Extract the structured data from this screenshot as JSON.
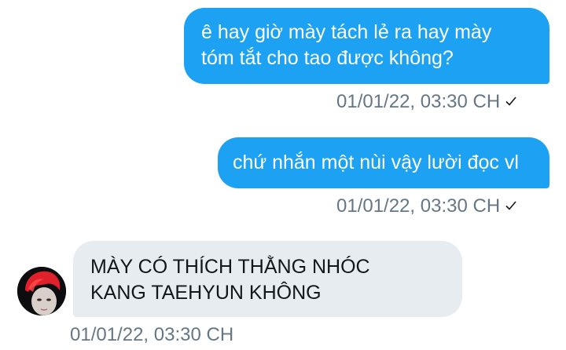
{
  "messages": [
    {
      "direction": "sent",
      "text": "ê hay giờ mày tách lẻ ra hay mày\ntóm tắt cho tao được không?",
      "timestamp": "01/01/22, 03:30 CH",
      "status_icon": "check-icon"
    },
    {
      "direction": "sent",
      "text": "chứ nhắn một nùi vậy lười đọc vl",
      "timestamp": "01/01/22, 03:30 CH",
      "status_icon": "check-icon"
    },
    {
      "direction": "received",
      "text": "MÀY CÓ THÍCH THẰNG NHÓC\nKANG TAEHYUN KHÔNG",
      "timestamp": "01/01/22, 03:30 CH",
      "avatar_icon": "user-avatar"
    }
  ],
  "colors": {
    "sent_bubble": "#1da1f2",
    "received_bubble": "#e6ecf0",
    "timestamp": "#657786",
    "avatar_hair": "#e0202a"
  }
}
